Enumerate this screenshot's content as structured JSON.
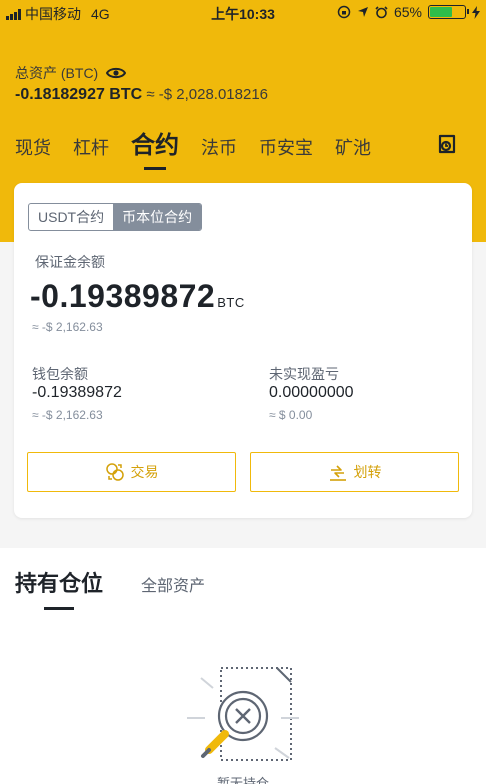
{
  "status_bar": {
    "carrier": "中国移动",
    "network": "4G",
    "time": "上午10:33",
    "battery": "65%",
    "battery_level": 0.65,
    "icons": [
      "signal-icon",
      "screen-lock-icon",
      "location-icon",
      "alarm-icon",
      "battery-icon",
      "charging-icon"
    ]
  },
  "header": {
    "total_label": "总资产 (BTC)",
    "total_btc": "-0.18182927 BTC",
    "total_usd": "≈ -$ 2,028.018216",
    "eye_icon": "eye-icon"
  },
  "tabs": [
    {
      "label": "现货",
      "active": false
    },
    {
      "label": "杠杆",
      "active": false
    },
    {
      "label": "合约",
      "active": true
    },
    {
      "label": "法币",
      "active": false
    },
    {
      "label": "币安宝",
      "active": false
    },
    {
      "label": "矿池",
      "active": false
    }
  ],
  "record_icon": "records-icon",
  "card": {
    "segments": [
      {
        "label": "USDT合约",
        "active": false
      },
      {
        "label": "币本位合约",
        "active": true
      }
    ],
    "margin_label": "保证金余额",
    "margin_value": "-0.19389872",
    "margin_unit": "BTC",
    "margin_usd": "≈ -$ 2,162.63",
    "wallet_label": "钱包余额",
    "wallet_value": "-0.19389872",
    "wallet_usd": "≈ -$ 2,162.63",
    "pnl_label": "未实现盈亏",
    "pnl_value": "0.00000000",
    "pnl_usd": "≈ $ 0.00",
    "trade_button": "交易",
    "transfer_button": "划转"
  },
  "positions": {
    "tab_active": "持有仓位",
    "tab_other": "全部资产",
    "empty_text": "暂无持仓"
  },
  "colors": {
    "brand": "#f0b90b",
    "text": "#1e2329",
    "muted": "#848e9c"
  }
}
